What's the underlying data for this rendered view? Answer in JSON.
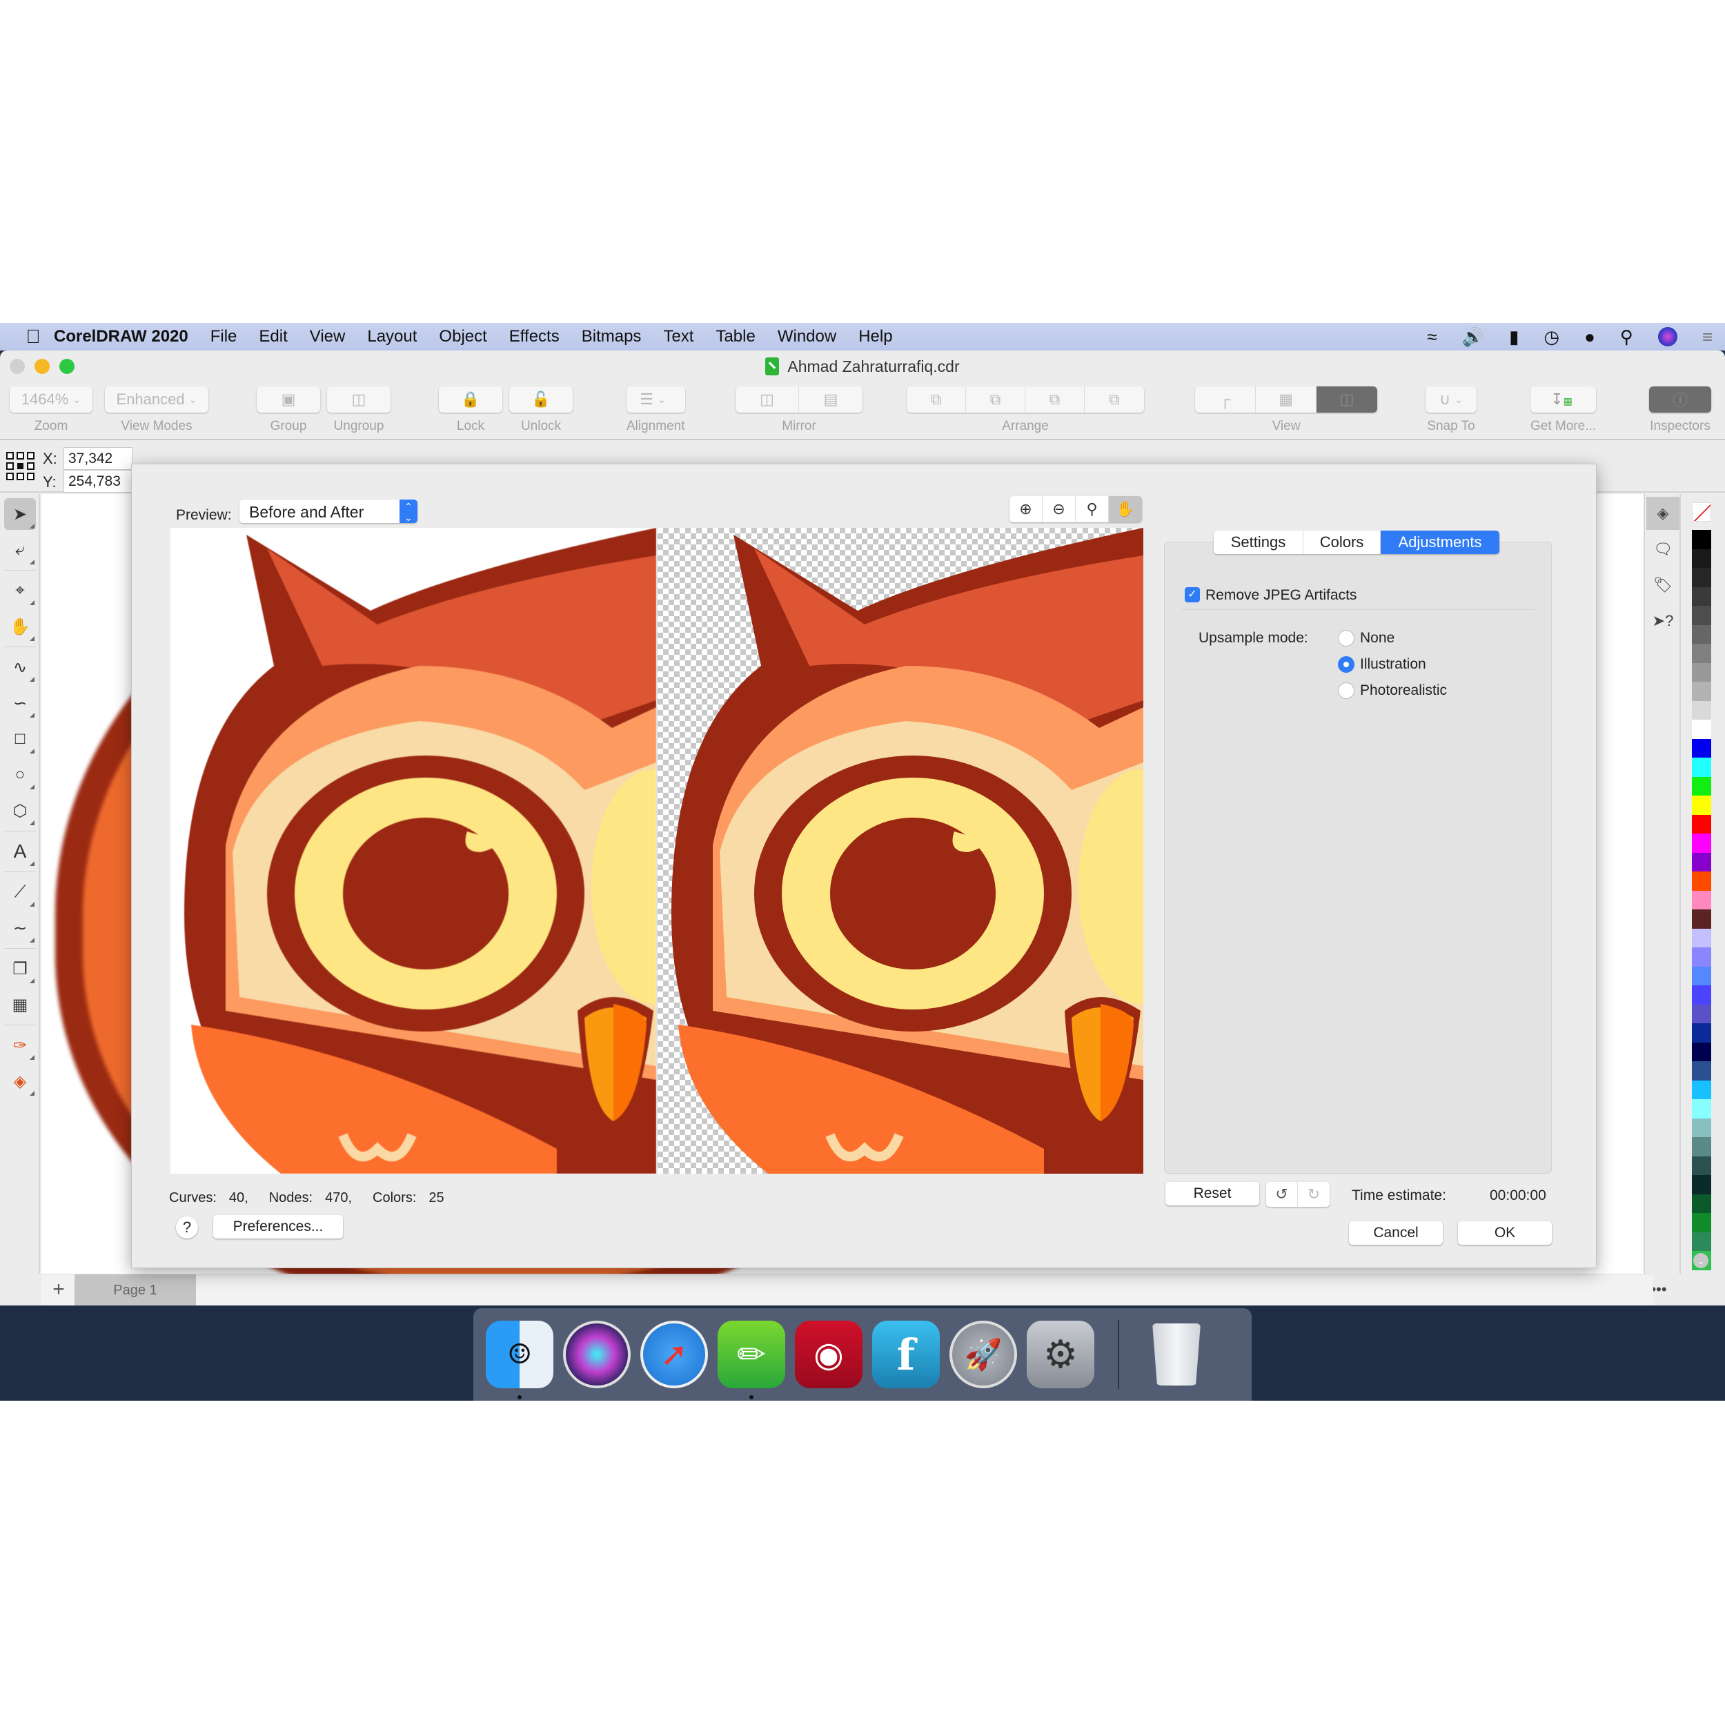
{
  "menubar": {
    "app_name": "CorelDRAW 2020",
    "menus": [
      "File",
      "Edit",
      "View",
      "Layout",
      "Object",
      "Effects",
      "Bitmaps",
      "Text",
      "Table",
      "Window",
      "Help"
    ],
    "status_icons": [
      "wifi-icon",
      "volume-icon",
      "battery-icon",
      "clock-icon",
      "user-icon",
      "spotlight-search-icon",
      "siri-icon",
      "notification-center-icon"
    ]
  },
  "window": {
    "title": "Ahmad Zahraturrafiq.cdr"
  },
  "toolbar": {
    "zoom_value": "1464%",
    "zoom_label": "Zoom",
    "view_mode_value": "Enhanced",
    "view_modes_label": "View Modes",
    "group_label": "Group",
    "ungroup_label": "Ungroup",
    "lock_label": "Lock",
    "unlock_label": "Unlock",
    "alignment_label": "Alignment",
    "mirror_label": "Mirror",
    "arrange_label": "Arrange",
    "view_label": "View",
    "snap_to_label": "Snap To",
    "get_more_label": "Get More...",
    "inspectors_label": "Inspectors"
  },
  "propbar": {
    "x_label": "X:",
    "x_value": "37,342",
    "y_label": "Y:",
    "y_value": "254,783"
  },
  "toolbox": {
    "tools": [
      "pick-tool",
      "shape-tool",
      "crop-tool",
      "pan-tool",
      "freehand-tool",
      "artistic-media-tool",
      "rectangle-tool",
      "ellipse-tool",
      "polygon-tool",
      "text-tool",
      "parallel-dimension-tool",
      "connector-tool",
      "drop-shadow-tool",
      "transparency-tool",
      "eyedropper-tool",
      "interactive-fill-tool"
    ]
  },
  "palette": {
    "colors": [
      "#000000",
      "#1a1a1a",
      "#262626",
      "#3a3a3a",
      "#4d4d4d",
      "#666666",
      "#808080",
      "#999999",
      "#b3b3b3",
      "#d9d9d9",
      "#ffffff",
      "#0000ee",
      "#22ffff",
      "#11ee11",
      "#ffff00",
      "#ff0000",
      "#ff00ff",
      "#8800cc",
      "#ff4a00",
      "#ff88c0",
      "#5a2424",
      "#c4c0ff",
      "#8a86ff",
      "#5588ff",
      "#4a44ff",
      "#5a50c8",
      "#0a2a9a",
      "#000050",
      "#2a5090",
      "#18c0ff",
      "#88ffff",
      "#88c0c0",
      "#5a8a88",
      "#2a5050",
      "#0a2a2a",
      "#0a5a2a",
      "#108a2a",
      "#2a8a5a",
      "#30c050"
    ]
  },
  "pages": {
    "add_label": "+",
    "current_page": "Page 1"
  },
  "dialog": {
    "preview_label": "Preview:",
    "preview_mode": "Before and After",
    "stats": {
      "curves_label": "Curves:",
      "curves_value": "40,",
      "nodes_label": "Nodes:",
      "nodes_value": "470,",
      "colors_label": "Colors:",
      "colors_value": "25"
    },
    "help_label": "?",
    "preferences_label": "Preferences...",
    "tabs": [
      "Settings",
      "Colors",
      "Adjustments"
    ],
    "active_tab": "Adjustments",
    "remove_jpeg_artifacts_label": "Remove JPEG Artifacts",
    "remove_jpeg_artifacts_checked": true,
    "upsample_label": "Upsample mode:",
    "upsample_options": [
      "None",
      "Illustration",
      "Photorealistic"
    ],
    "upsample_selected": "Illustration",
    "reset_label": "Reset",
    "time_estimate_label": "Time estimate:",
    "time_estimate_value": "00:00:00",
    "cancel_label": "Cancel",
    "ok_label": "OK"
  },
  "dock": {
    "apps": [
      "Finder",
      "Siri",
      "Safari",
      "CorelDRAW",
      "Photo Booth",
      "Fontself",
      "Launchpad",
      "System Preferences"
    ],
    "trash": "Trash"
  },
  "colors": {
    "accent": "#2f7cf6",
    "owl_outline": "#9b2812",
    "owl_head": "#dd5533",
    "owl_eye": "#fee684",
    "owl_beak": "#fa9810"
  }
}
